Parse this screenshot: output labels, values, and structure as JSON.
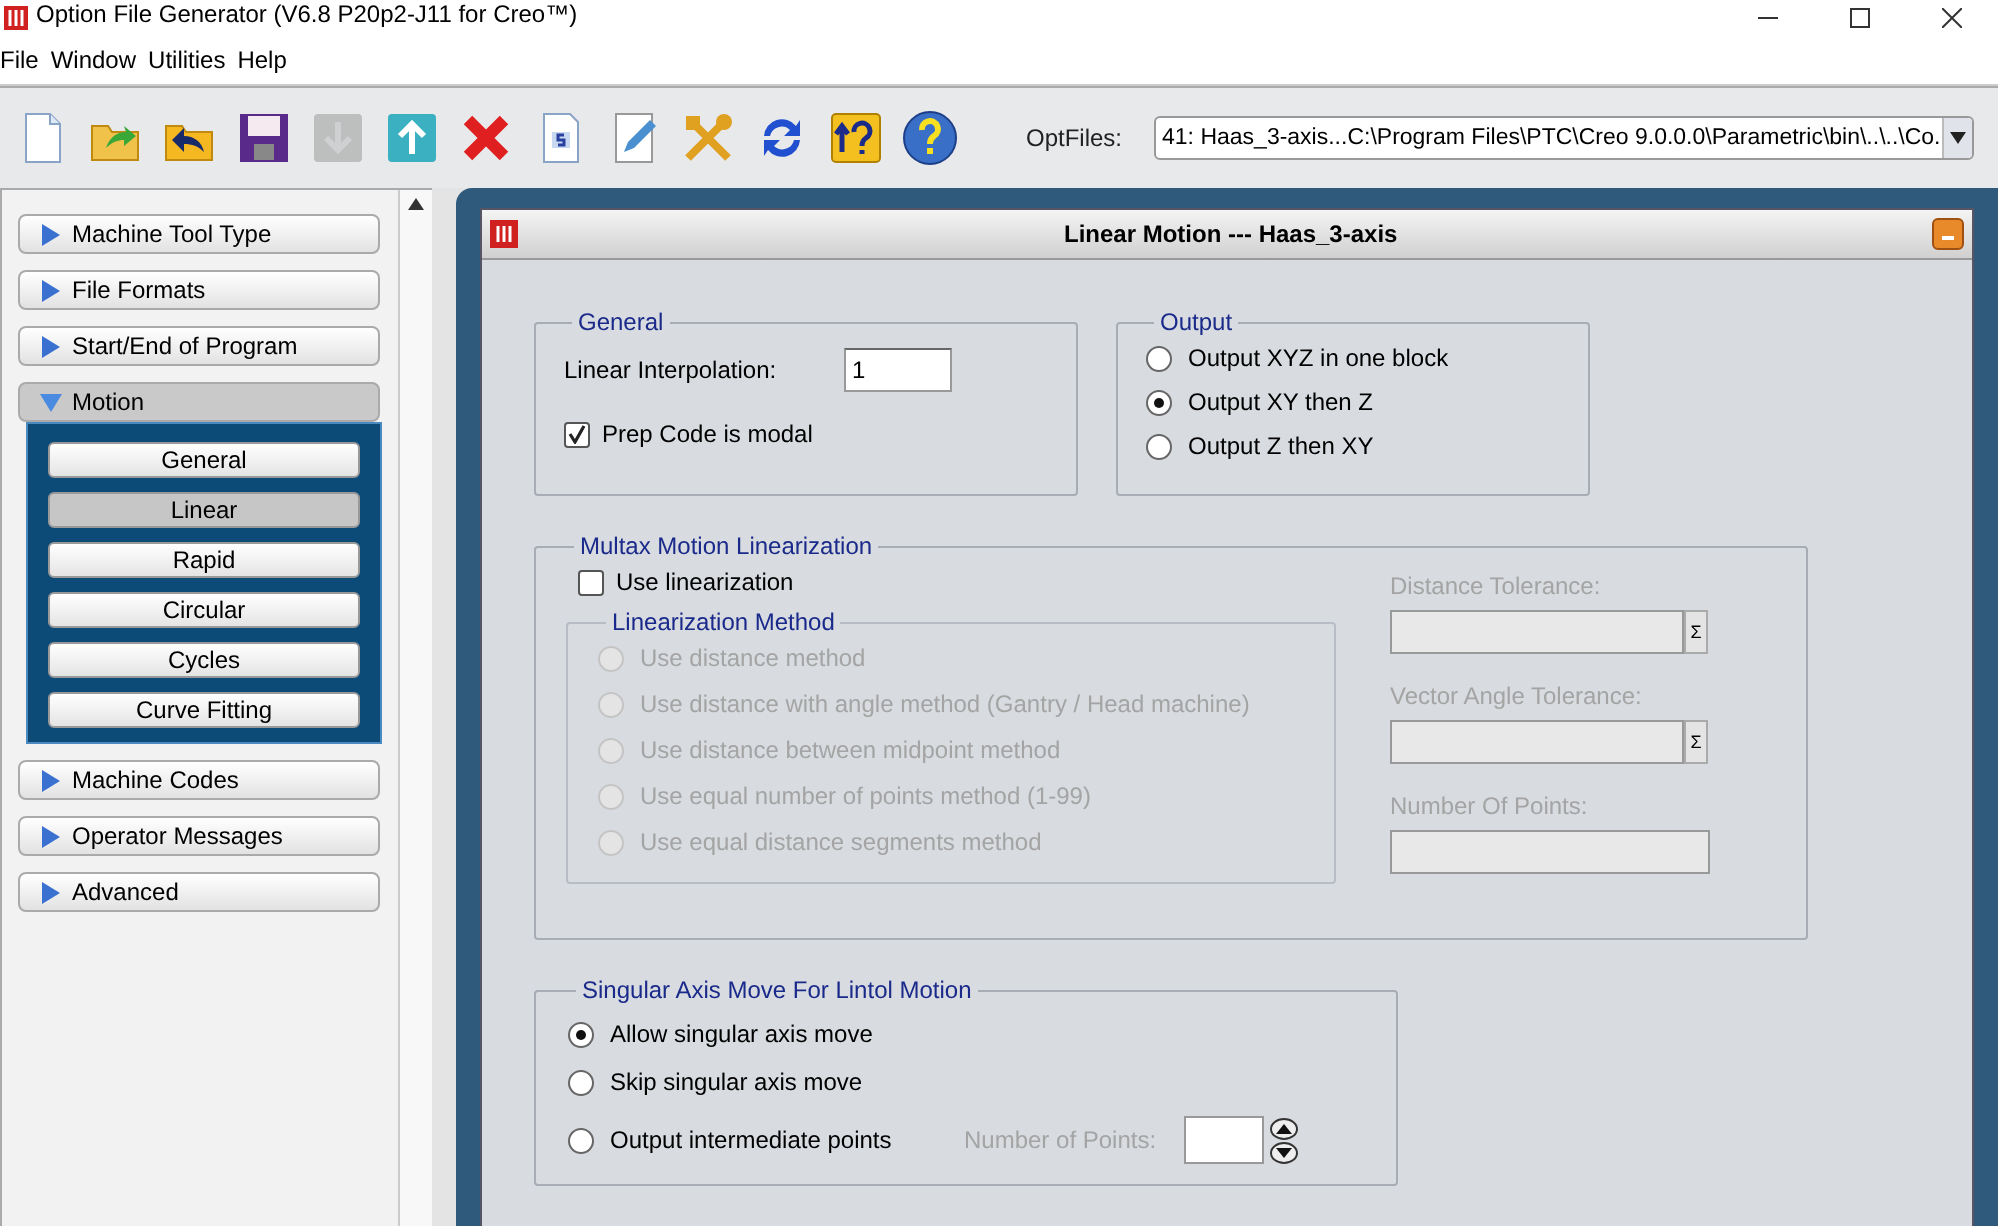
{
  "window": {
    "title": "Option File Generator (V6.8 P20p2-J11 for Creo™)"
  },
  "menu": [
    {
      "label": "File"
    },
    {
      "label": "Window"
    },
    {
      "label": "Utilities"
    },
    {
      "label": "Help"
    }
  ],
  "toolbar": {
    "buttons": [
      {
        "kind": "new",
        "disabled": false
      },
      {
        "kind": "open",
        "disabled": false
      },
      {
        "kind": "revert",
        "disabled": false
      },
      {
        "kind": "save",
        "disabled": false
      },
      {
        "kind": "download",
        "disabled": true
      },
      {
        "kind": "upload",
        "disabled": false
      },
      {
        "kind": "delete",
        "disabled": false
      },
      {
        "kind": "script",
        "disabled": false
      },
      {
        "kind": "edit",
        "disabled": false
      },
      {
        "kind": "tools",
        "disabled": false
      },
      {
        "kind": "refresh",
        "disabled": false
      },
      {
        "kind": "context-help",
        "disabled": false
      },
      {
        "kind": "help",
        "disabled": false
      }
    ],
    "optfiles_label": "OptFiles:",
    "optfiles_value": "41:  Haas_3-axis...C:\\Program Files\\PTC\\Creo 9.0.0.0\\Parametric\\bin\\..\\..\\Co."
  },
  "sidebar": {
    "sections": [
      {
        "label": "Machine Tool Type",
        "expanded": false
      },
      {
        "label": "File Formats",
        "expanded": false
      },
      {
        "label": "Start/End of Program",
        "expanded": false
      },
      {
        "label": "Motion",
        "expanded": true,
        "children": [
          {
            "label": "General",
            "selected": false
          },
          {
            "label": "Linear",
            "selected": true
          },
          {
            "label": "Rapid",
            "selected": false
          },
          {
            "label": "Circular",
            "selected": false
          },
          {
            "label": "Cycles",
            "selected": false
          },
          {
            "label": "Curve Fitting",
            "selected": false
          }
        ]
      },
      {
        "label": "Machine Codes",
        "expanded": false
      },
      {
        "label": "Operator Messages",
        "expanded": false
      },
      {
        "label": "Advanced",
        "expanded": false
      }
    ]
  },
  "dialog": {
    "title": "Linear Motion --- Haas_3-axis",
    "general": {
      "title": "General",
      "interpolation_label": "Linear Interpolation:",
      "interpolation_value": "1",
      "modal": {
        "label": "Prep Code is modal",
        "checked": true
      }
    },
    "output": {
      "title": "Output",
      "options": [
        {
          "label": "Output XYZ in one block",
          "selected": false
        },
        {
          "label": "Output XY then Z",
          "selected": true
        },
        {
          "label": "Output Z then XY",
          "selected": false
        }
      ]
    },
    "linearization": {
      "title": "Multax Motion Linearization",
      "use": {
        "label": "Use linearization",
        "checked": false
      },
      "method": {
        "title": "Linearization Method",
        "disabled": true,
        "options": [
          {
            "label": "Use distance method",
            "selected": false
          },
          {
            "label": "Use distance with angle method (Gantry / Head machine)",
            "selected": false
          },
          {
            "label": "Use distance between midpoint method",
            "selected": false
          },
          {
            "label": "Use equal number of points method (1-99)",
            "selected": false
          },
          {
            "label": "Use equal distance segments method",
            "selected": false
          }
        ]
      },
      "fields": [
        {
          "label": "Distance Tolerance:",
          "kind": "sigma",
          "button_label": "Σ",
          "disabled": true
        },
        {
          "label": "Vector Angle Tolerance:",
          "kind": "sigma",
          "button_label": "Σ",
          "disabled": true
        },
        {
          "label": "Number Of Points:",
          "kind": "plain",
          "disabled": true
        }
      ]
    },
    "singular": {
      "title": "Singular Axis Move For Lintol Motion",
      "options": [
        {
          "label": "Allow singular axis move",
          "selected": true
        },
        {
          "label": "Skip singular axis move",
          "selected": false
        },
        {
          "label": "Output intermediate points",
          "selected": false
        }
      ],
      "points_label": "Number of Points:"
    }
  }
}
